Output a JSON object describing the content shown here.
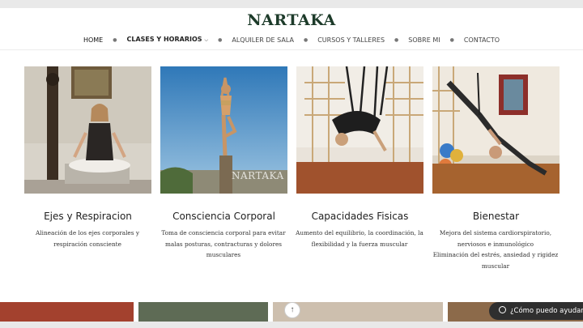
{
  "site": {
    "brand": "NARTAKA"
  },
  "nav": {
    "items": [
      {
        "label": "HOME"
      },
      {
        "label": "CLASES Y HORARIOS"
      },
      {
        "label": "ALQUILER DE SALA"
      },
      {
        "label": "CURSOS Y TALLERES"
      },
      {
        "label": "SOBRE MI"
      },
      {
        "label": "CONTACTO"
      }
    ]
  },
  "cards": [
    {
      "title": "Ejes y Respiracion",
      "lines": [
        "Alineación de los ejes corporales y",
        "respiración consciente"
      ]
    },
    {
      "title": "Consciencia Corporal",
      "watermark": "NARTAKA",
      "lines": [
        "Toma de consciencia corporal para evitar",
        "malas posturas, contracturas y dolores",
        "musculares"
      ]
    },
    {
      "title": "Capacidades Fisicas",
      "lines": [
        "Aumento del equilibrio, la coordinación, la",
        "flexibilidad y la fuerza muscular"
      ]
    },
    {
      "title": "Bienestar",
      "lines": [
        "Mejora del sistema cardiorspiratorio,",
        "nerviosos e inmunológico",
        "Eliminación del estrés, ansiedad y rigidez",
        "muscular"
      ]
    }
  ],
  "chat": {
    "label": "¿Cómo puedo ayudarte?"
  },
  "scroll_top": {
    "glyph": "↑"
  },
  "colors": {
    "brand": "#1d3b2a",
    "chat_bg": "#2f2f2f"
  }
}
